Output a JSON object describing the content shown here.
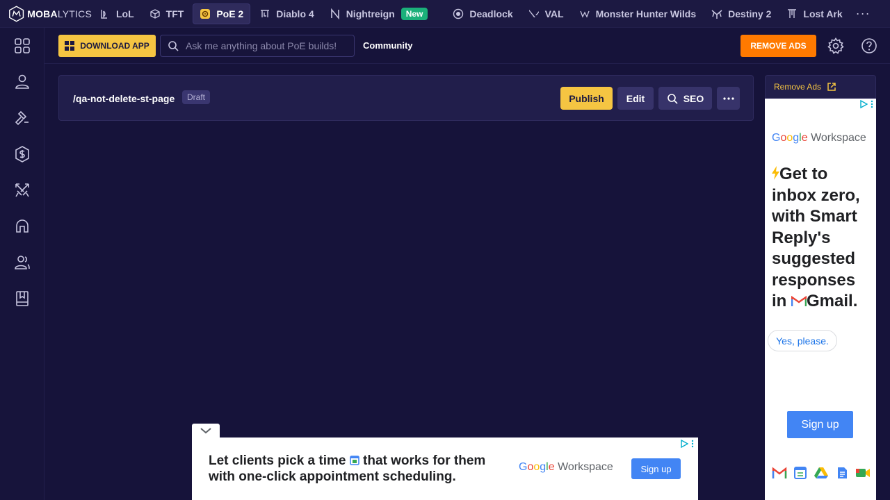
{
  "brand": {
    "logo_bold": "MOBA",
    "logo_thin": "LYTICS"
  },
  "nav": {
    "tabs": [
      {
        "label": "LoL",
        "icon": "lol-icon"
      },
      {
        "label": "TFT",
        "icon": "tft-icon"
      },
      {
        "label": "PoE 2",
        "icon": "poe2-icon",
        "active": true
      },
      {
        "label": "Diablo 4",
        "icon": "diablo4-icon"
      },
      {
        "label": "Nightreign",
        "icon": "nightreign-icon",
        "badge": "New"
      },
      {
        "label": "Deadlock",
        "icon": "deadlock-icon"
      },
      {
        "label": "VAL",
        "icon": "valorant-icon"
      },
      {
        "label": "Monster Hunter Wilds",
        "icon": "monster-hunter-icon"
      },
      {
        "label": "Destiny 2",
        "icon": "destiny2-icon"
      },
      {
        "label": "Lost Ark",
        "icon": "lost-ark-icon"
      }
    ],
    "more": "···"
  },
  "sidebar": {
    "icons": [
      "grid-icon",
      "user-icon",
      "hammer-icon",
      "currency-icon",
      "swords-icon",
      "helmet-icon",
      "community-icon",
      "book-icon"
    ]
  },
  "header": {
    "download_label": "DOWNLOAD APP",
    "search_placeholder": "Ask me anything about PoE builds!",
    "community_label": "Community",
    "remove_ads_label": "REMOVE ADS"
  },
  "page": {
    "slug": "/qa-not-delete-st-page",
    "status": "Draft",
    "publish_label": "Publish",
    "edit_label": "Edit",
    "seo_label": "SEO"
  },
  "side_ad": {
    "remove_ads_link": "Remove Ads",
    "brand_g": [
      "G",
      "o",
      "o",
      "g",
      "l",
      "e"
    ],
    "brand_ws": "Workspace",
    "headline": "Get to inbox zero, with Smart Reply's suggested responses in",
    "headline_end": "Gmail.",
    "yes_label": "Yes, please.",
    "signup_label": "Sign up"
  },
  "bottom_ad": {
    "line1_a": "Let clients pick a time",
    "line1_b": "that works for them",
    "line2": "with one-click appointment scheduling.",
    "brand_ws": "Workspace",
    "signup_label": "Sign up"
  },
  "colors": {
    "background": "#16133a",
    "accent_yellow": "#f5c542",
    "accent_orange": "#ff7a00",
    "new_badge": "#1bb07a",
    "google_blue": "#4285f4"
  }
}
